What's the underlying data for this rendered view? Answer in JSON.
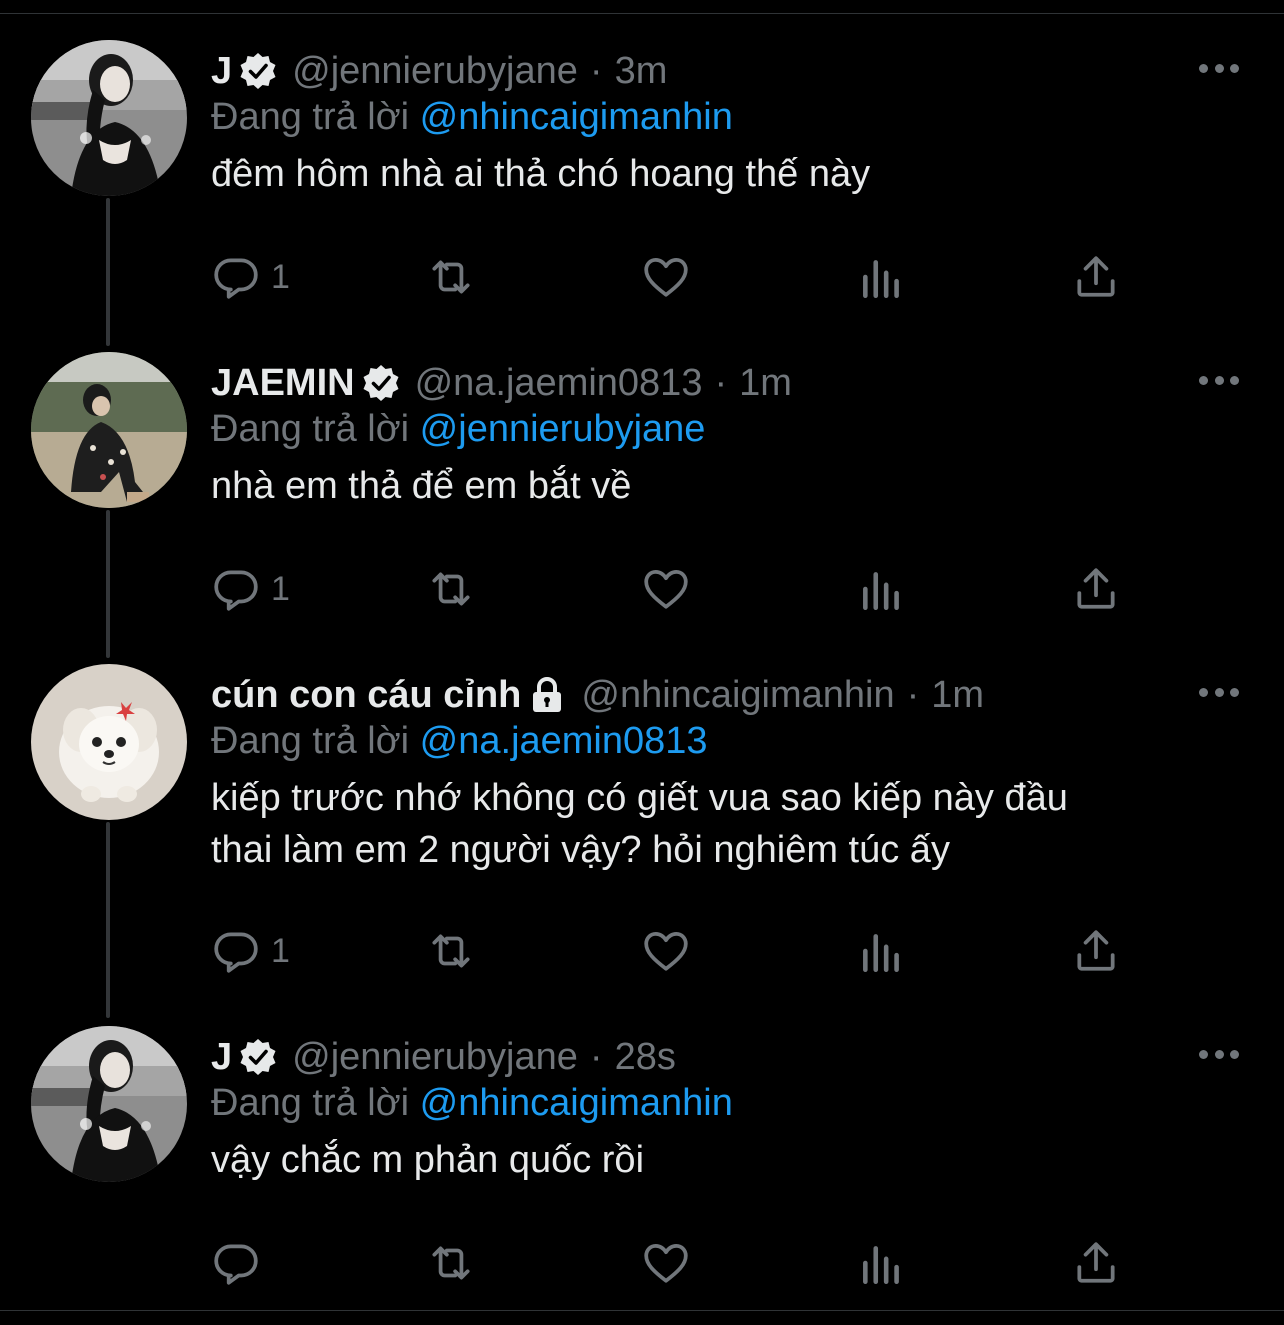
{
  "colors": {
    "background": "#000000",
    "text": "#e7e9ea",
    "muted": "#71767b",
    "link": "#1d9bf0",
    "thread_line": "#333639"
  },
  "tweets": [
    {
      "display_name": "J",
      "badge": "verified-badge-icon",
      "handle": "@jennierubyjane",
      "separator": "·",
      "time": "3m",
      "reply_prefix": "Đang trả lời",
      "reply_to": "@nhincaigimanhin",
      "text": "đêm hôm nhà ai thả chó hoang thế này",
      "reply_count": "1"
    },
    {
      "display_name": "JAEMIN",
      "badge": "verified-badge-icon",
      "handle": "@na.jaemin0813",
      "separator": "·",
      "time": "1m",
      "reply_prefix": "Đang trả lời",
      "reply_to": "@jennierubyjane",
      "text": "nhà em thả để em bắt về",
      "reply_count": "1"
    },
    {
      "display_name": "cún con cáu cỉnh",
      "badge": "lock-icon",
      "handle": "@nhincaigimanhin",
      "separator": "·",
      "time": "1m",
      "reply_prefix": "Đang trả lời",
      "reply_to": "@na.jaemin0813",
      "text_line1": "kiếp trước nhớ không có giết vua sao kiếp này đầu",
      "text_line2": "thai làm em 2 người vậy? hỏi nghiêm túc ấy",
      "reply_count": "1"
    },
    {
      "display_name": "J",
      "badge": "verified-badge-icon",
      "handle": "@jennierubyjane",
      "separator": "·",
      "time": "28s",
      "reply_prefix": "Đang trả lời",
      "reply_to": "@nhincaigimanhin",
      "text": "vậy chắc m phản quốc rồi",
      "reply_count": ""
    }
  ],
  "icons": {
    "reply": "reply-bubble-icon",
    "retweet": "retweet-icon",
    "like": "heart-icon",
    "views": "analytics-bars-icon",
    "share": "share-upload-icon",
    "more": "more-dots-icon"
  }
}
